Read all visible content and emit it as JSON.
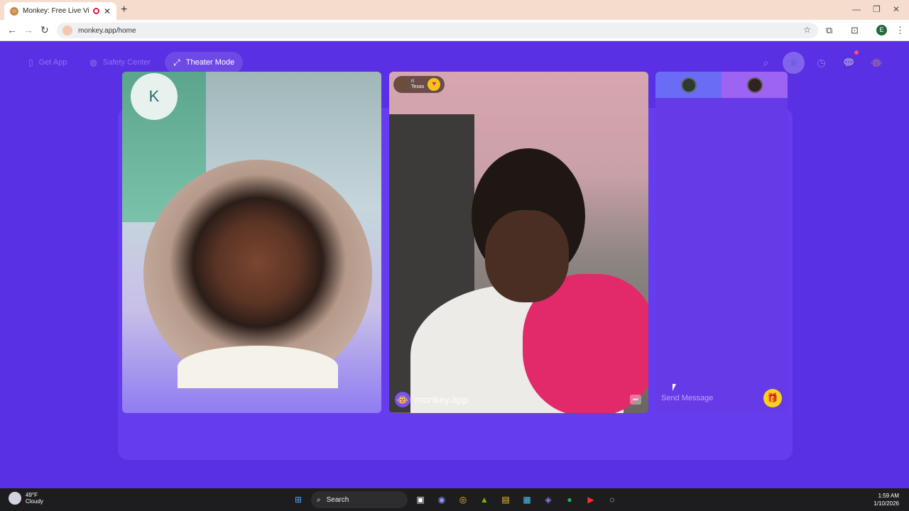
{
  "browser": {
    "tab_title": "Monkey: Free Live Video Ch",
    "new_tab": "+",
    "url": "monkey.app/home",
    "profile_initial": "E",
    "window_controls": {
      "minimize": "—",
      "restore": "❐",
      "close": "✕"
    }
  },
  "topnav": {
    "get_app": "Get App",
    "safety_center": "Safety Center",
    "theater_mode": "Theater Mode"
  },
  "top_icons": {
    "notification_count": "3"
  },
  "video_left": {
    "logo_glyph": "K"
  },
  "video_right": {
    "username": "ri",
    "location": "Texas",
    "brand": "monkey.app"
  },
  "chat": {
    "placeholder": "Send Message"
  },
  "taskbar": {
    "temperature": "49°F",
    "condition": "Cloudy",
    "search_label": "Search",
    "time": "1:59 AM",
    "date": "1/10/2026"
  },
  "colors": {
    "background": "#5930e3",
    "accent_purple": "#673ae8",
    "gift_yellow": "#f8d21a"
  }
}
